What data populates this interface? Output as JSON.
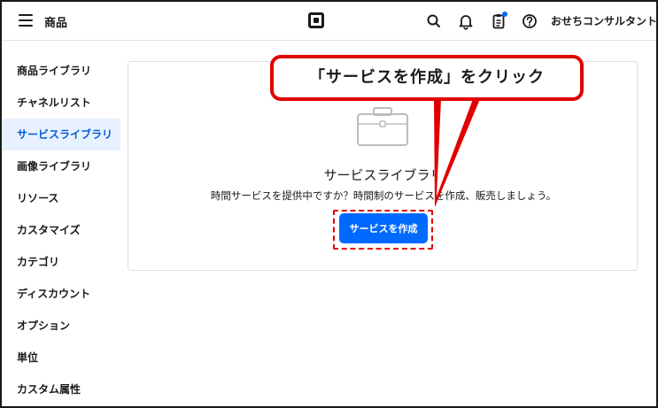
{
  "header": {
    "title": "商品",
    "account_name": "おせちコンサルタント"
  },
  "sidebar": {
    "items": [
      {
        "label": "商品ライブラリ"
      },
      {
        "label": "チャネルリスト"
      },
      {
        "label": "サービスライブラリ",
        "active": true
      },
      {
        "label": "画像ライブラリ"
      },
      {
        "label": "リソース"
      },
      {
        "label": "カスタマイズ"
      },
      {
        "label": "カテゴリ"
      },
      {
        "label": "ディスカウント"
      },
      {
        "label": "オプション"
      },
      {
        "label": "単位"
      },
      {
        "label": "カスタム属性"
      }
    ]
  },
  "main": {
    "empty_title": "サービスライブラリ",
    "empty_description": "時間サービスを提供中ですか？時間制のサービスを作成、販売しましょう。",
    "create_button_label": "サービスを作成"
  },
  "annotation": {
    "callout_text": "「サービスを作成」をクリック"
  },
  "colors": {
    "accent": "#006aff",
    "active_bg": "#e8f1ff",
    "annotation_red": "#e00000"
  }
}
